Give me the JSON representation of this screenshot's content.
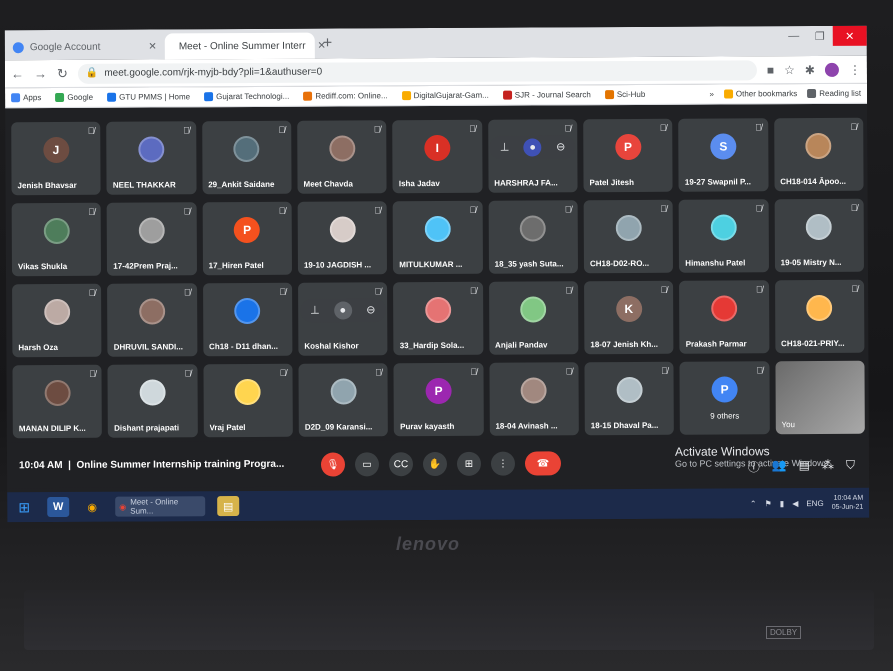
{
  "browser": {
    "tabs": [
      {
        "label": "Google Account",
        "active": false
      },
      {
        "label": "Meet - Online Summer Interr",
        "active": true
      }
    ],
    "url": "meet.google.com/rjk-myjb-bdy?pli=1&authuser=0",
    "bookmarks": [
      {
        "label": "Apps",
        "color": "#4285f4"
      },
      {
        "label": "Google",
        "color": "#34a853"
      },
      {
        "label": "GTU PMMS | Home",
        "color": "#1a73e8"
      },
      {
        "label": "Gujarat Technologi...",
        "color": "#1a73e8"
      },
      {
        "label": "Rediff.com: Online...",
        "color": "#e8710a"
      },
      {
        "label": "DigitalGujarat-Gam...",
        "color": "#f9ab00"
      },
      {
        "label": "SJR - Journal Search",
        "color": "#c5221f"
      },
      {
        "label": "Sci-Hub",
        "color": "#e37400"
      }
    ],
    "other_bookmarks": "Other bookmarks",
    "reading_list": "Reading list"
  },
  "participants": [
    {
      "name": "Jenish Bhavsar",
      "initial": "J",
      "color": "#6d4c41"
    },
    {
      "name": "NEEL THAKKAR",
      "initial": "",
      "color": "#5c6bc0"
    },
    {
      "name": "29_Ankit Saidane",
      "initial": "",
      "color": "#546e7a"
    },
    {
      "name": "Meet Chavda",
      "initial": "",
      "color": "#8d6e63"
    },
    {
      "name": "Isha Jadav",
      "initial": "I",
      "color": "#d93025"
    },
    {
      "name": "HARSHRAJ FA...",
      "initial": "",
      "color": "#3f51b5",
      "hover": true
    },
    {
      "name": "Patel Jitesh",
      "initial": "P",
      "color": "#e8453c"
    },
    {
      "name": "19-27 Swapnil P...",
      "initial": "S",
      "color": "#5b8def"
    },
    {
      "name": "CH18-014 Āpoo...",
      "initial": "",
      "color": "#b8865a"
    },
    {
      "name": "Vikas Shukla",
      "initial": "",
      "color": "#4e7d5b"
    },
    {
      "name": "17-42Prem Praj...",
      "initial": "",
      "color": "#9e9e9e"
    },
    {
      "name": "17_Hiren Patel",
      "initial": "P",
      "color": "#f4511e"
    },
    {
      "name": "19-10 JAGDISH ...",
      "initial": "",
      "color": "#d7ccc8"
    },
    {
      "name": "MITULKUMAR ...",
      "initial": "",
      "color": "#4fc3f7"
    },
    {
      "name": "18_35 yash Suta...",
      "initial": "",
      "color": "#6d6d6d"
    },
    {
      "name": "CH18-D02-RO...",
      "initial": "",
      "color": "#90a4ae"
    },
    {
      "name": "Himanshu Patel",
      "initial": "",
      "color": "#4dd0e1"
    },
    {
      "name": "19-05 Mistry N...",
      "initial": "",
      "color": "#b0bec5"
    },
    {
      "name": "Harsh Oza",
      "initial": "",
      "color": "#bcaaa4"
    },
    {
      "name": "DHRUVIL SANDI...",
      "initial": "",
      "color": "#8d6e63"
    },
    {
      "name": "Ch18 - D11 dhan...",
      "initial": "",
      "color": "#1a73e8"
    },
    {
      "name": "Koshal Kishor",
      "initial": "",
      "color": "#5f6368",
      "hover": true
    },
    {
      "name": "33_Hardip Sola...",
      "initial": "",
      "color": "#e57373"
    },
    {
      "name": "Anjali Pandav",
      "initial": "",
      "color": "#81c784"
    },
    {
      "name": "18-07 Jenish Kh...",
      "initial": "K",
      "color": "#8d6e63"
    },
    {
      "name": "Prakash Parmar",
      "initial": "",
      "color": "#e53935"
    },
    {
      "name": "CH18-021-PRIY...",
      "initial": "",
      "color": "#ffb74d"
    },
    {
      "name": "MANAN DILIP K...",
      "initial": "",
      "color": "#6d4c41"
    },
    {
      "name": "Dishant prajapati",
      "initial": "",
      "color": "#cfd8dc"
    },
    {
      "name": "Vraj Patel",
      "initial": "",
      "color": "#ffd54f"
    },
    {
      "name": "D2D_09 Karansi...",
      "initial": "",
      "color": "#90a4ae"
    },
    {
      "name": "Purav kayasth",
      "initial": "P",
      "color": "#9c27b0"
    },
    {
      "name": "18-04 Avinash ...",
      "initial": "",
      "color": "#a1887f"
    },
    {
      "name": "18-15 Dhaval Pa...",
      "initial": "",
      "color": "#b0bec5"
    },
    {
      "name": "9 others",
      "initial": "P",
      "color": "#4285f4",
      "others": true
    },
    {
      "name": "You",
      "initial": "",
      "color": "",
      "you": true
    }
  ],
  "meeting": {
    "time": "10:04 AM",
    "title": "Online Summer Internship training Progra..."
  },
  "activation": {
    "line1": "Activate Windows",
    "line2": "Go to PC settings to activate Windows."
  },
  "taskbar": {
    "chrome_label": "Meet - Online Sum...",
    "tray_lang": "ENG",
    "clock_time": "10:04 AM",
    "clock_date": "05-Jun-21"
  },
  "bezel": {
    "brand": "lenovo",
    "dolby": "DOLBY"
  }
}
